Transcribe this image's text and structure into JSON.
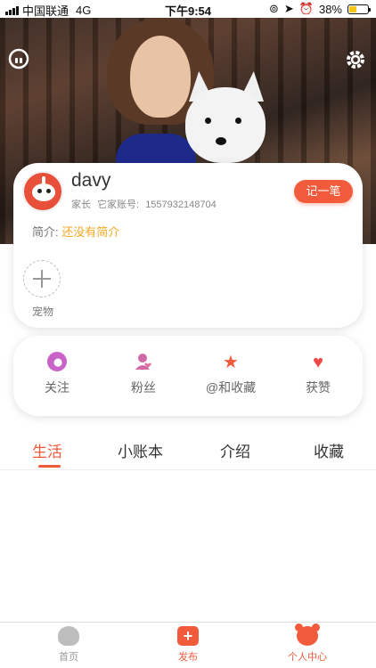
{
  "status_bar": {
    "carrier": "中国联通",
    "network": "4G",
    "time": "下午9:54",
    "battery": "38%",
    "battery_level": 0.38
  },
  "header": {
    "left_icon": "headset-icon",
    "right_icon": "gear-icon"
  },
  "profile": {
    "username": "davy",
    "role": "家长",
    "account_label": "它家账号:",
    "account_id": "1557932148704",
    "record_button": "记一笔",
    "bio_label": "简介:",
    "bio_value": "还没有简介",
    "pet_label": "宠物"
  },
  "stats": [
    {
      "label": "关注",
      "icon": "follow-icon"
    },
    {
      "label": "粉丝",
      "icon": "fans-icon"
    },
    {
      "label": "@和收藏",
      "icon": "star-icon"
    },
    {
      "label": "获赞",
      "icon": "heart-icon"
    }
  ],
  "tabs": [
    {
      "label": "生活",
      "active": true
    },
    {
      "label": "小账本",
      "active": false
    },
    {
      "label": "介绍",
      "active": false
    },
    {
      "label": "收藏",
      "active": false
    }
  ],
  "bottom_nav": [
    {
      "label": "首页",
      "icon": "home-icon",
      "active": false
    },
    {
      "label": "发布",
      "icon": "post-icon",
      "active": false
    },
    {
      "label": "个人中心",
      "icon": "profile-icon",
      "active": true
    }
  ],
  "colors": {
    "accent": "#f25a3c",
    "bio_value": "#f2a824"
  }
}
